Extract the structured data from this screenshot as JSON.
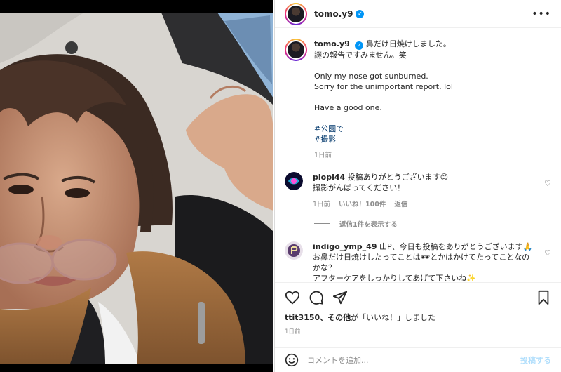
{
  "post": {
    "username": "tomo.y9",
    "verified_mark": "✓",
    "more_icon": "•••"
  },
  "caption": {
    "username": "tomo.y9",
    "line1": "鼻だけ日焼けしました。",
    "line2": "謎の報告ですみません。笑",
    "line3": "Only my nose got sunburned.",
    "line4": "Sorry for the unimportant report. lol",
    "line5": "Have a good one.",
    "hashtags": [
      "#公園で",
      "#撮影"
    ],
    "time": "1日前"
  },
  "comments": [
    {
      "username": "piopi44",
      "text1": "投稿ありがとうございます😊",
      "text2": "撮影がんばってください！",
      "time": "1日前",
      "likes": "いいね！100件",
      "reply": "返信",
      "view_replies": "返信1件を表示する"
    },
    {
      "username": "indigo_ymp_49",
      "text1": "山P、今日も投稿をありがとうございます🙏",
      "text2": "お鼻だけ日焼けしたってことは🕶とかはかけてたってことなのかな？",
      "text3": "アフターケアをしっかりしてあげて下さいね✨"
    }
  ],
  "likes_line": {
    "user": "ttit3150",
    "rest_bold": "、その他",
    "rest": "が「いいね！」しました"
  },
  "post_time": "1日前",
  "comment_box": {
    "placeholder": "コメントを追加...",
    "post_label": "投稿する"
  }
}
